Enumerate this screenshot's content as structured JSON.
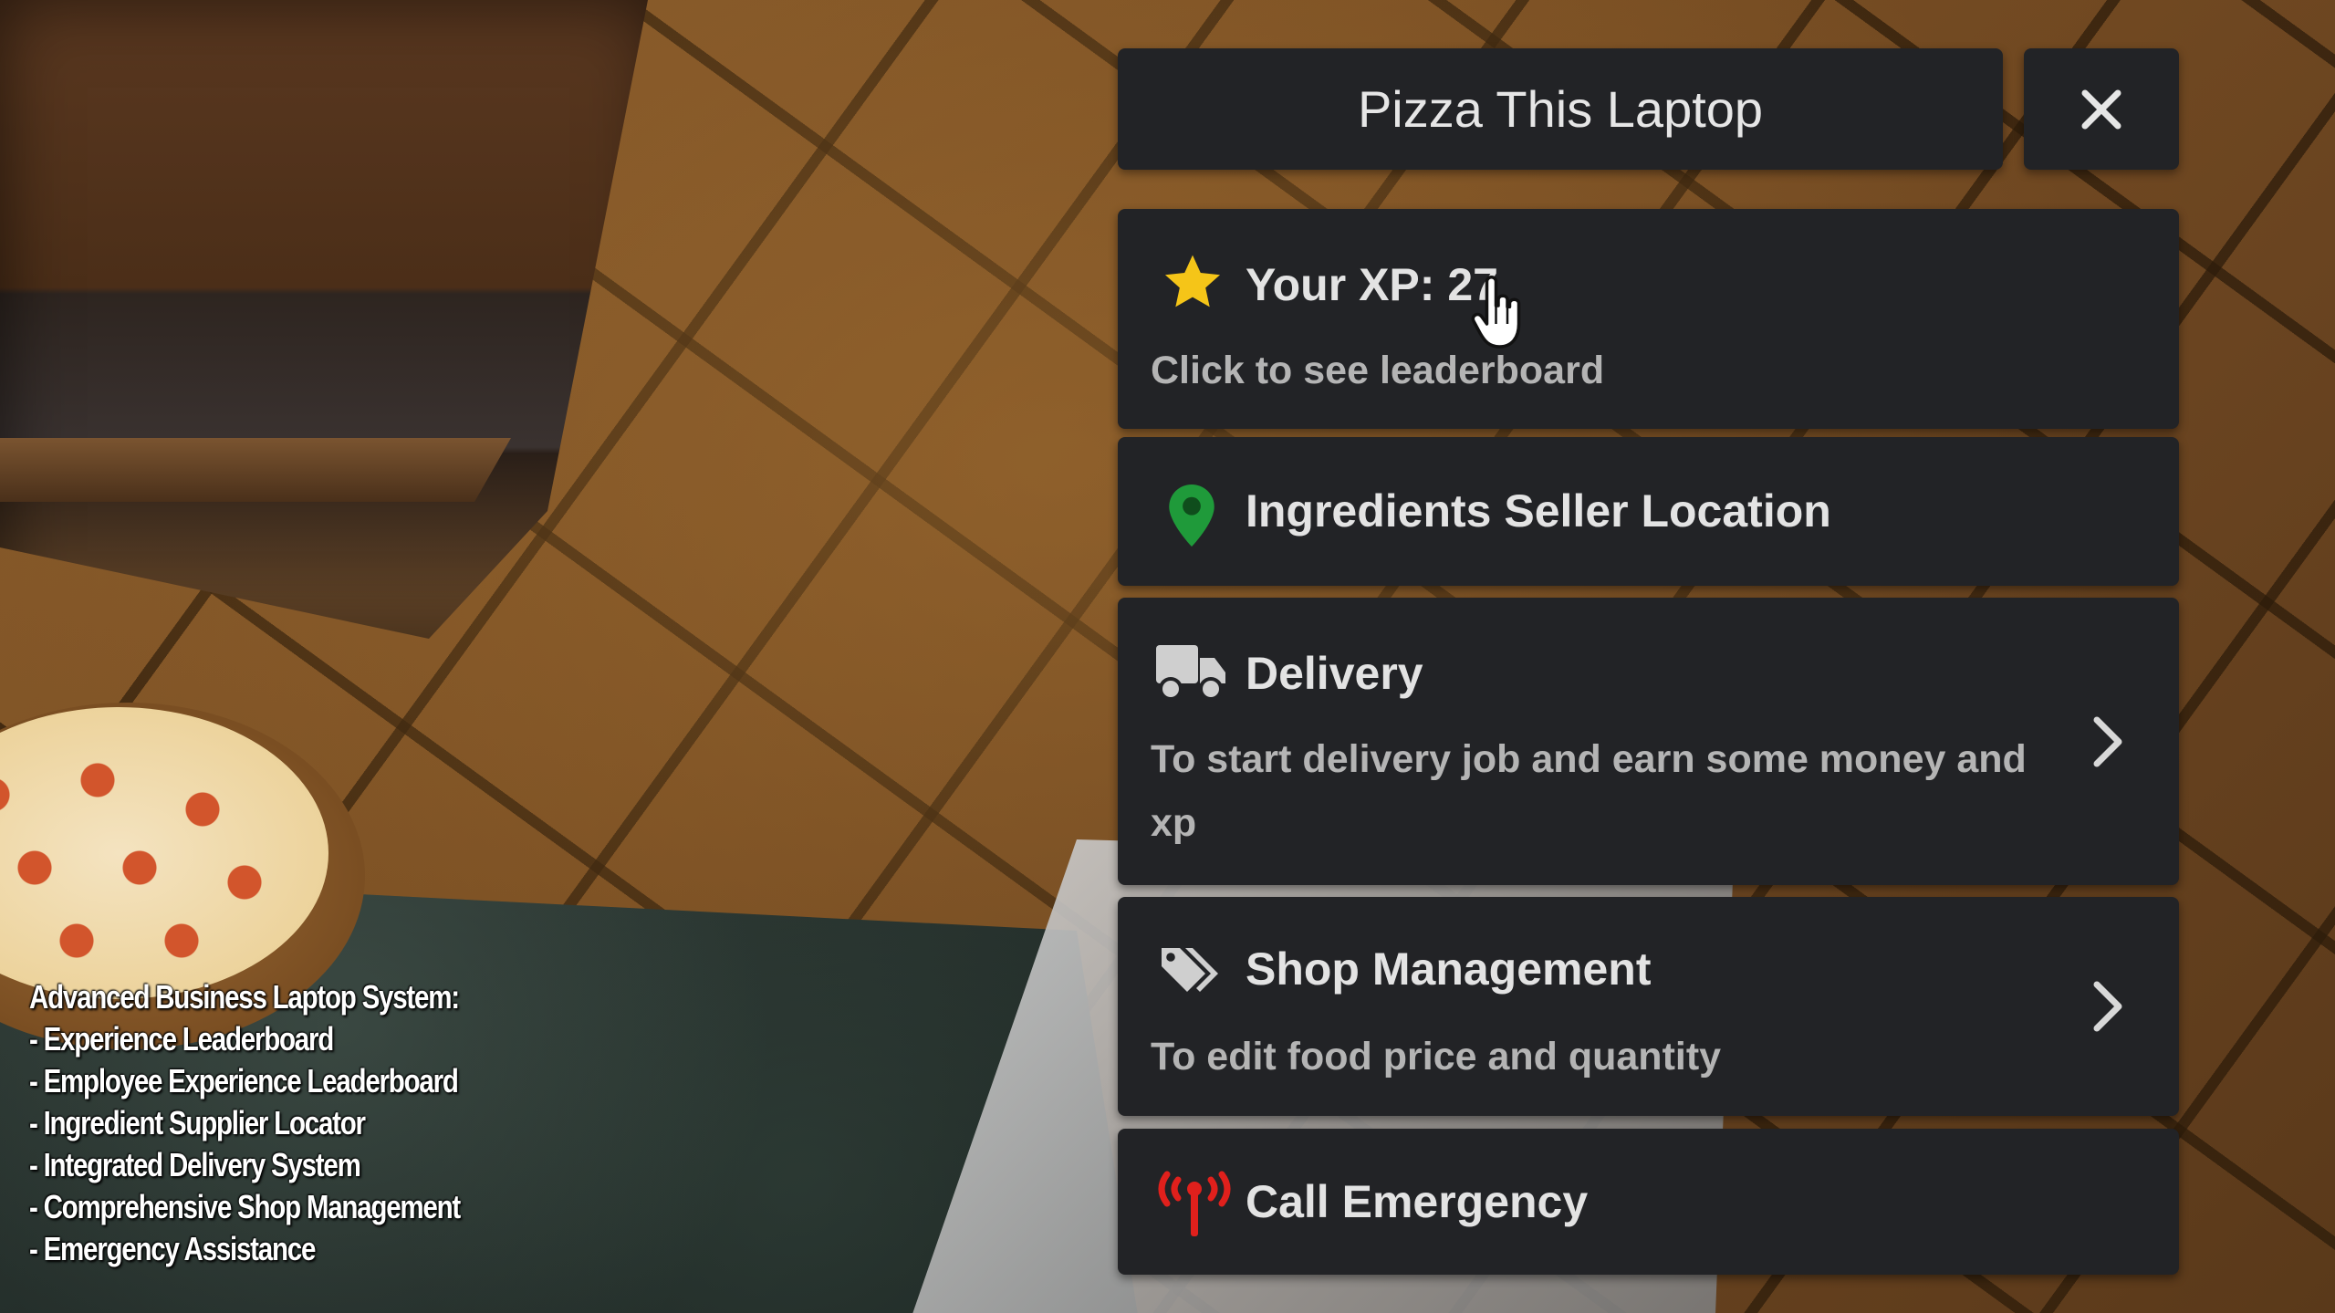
{
  "window": {
    "title": "Pizza This Laptop",
    "close_icon": "close-icon"
  },
  "menu": {
    "xp": {
      "icon": "star-icon",
      "title": "Your XP: 27",
      "subtitle": "Click to see leaderboard"
    },
    "ingredients": {
      "icon": "map-pin-icon",
      "title": "Ingredients Seller Location"
    },
    "delivery": {
      "icon": "truck-icon",
      "title": "Delivery",
      "description": "To start delivery job and earn some money and xp"
    },
    "shop": {
      "icon": "tags-icon",
      "title": "Shop Management",
      "description": "To edit food price and quantity"
    },
    "emergency": {
      "icon": "tower-broadcast-icon",
      "title": "Call Emergency"
    }
  },
  "caption": {
    "lines": [
      "Advanced Business Laptop System:",
      "- Experience Leaderboard",
      "- Employee Experience Leaderboard",
      "- Ingredient Supplier Locator",
      "- Integrated Delivery System",
      "- Comprehensive Shop Management",
      "- Emergency Assistance"
    ]
  },
  "colors": {
    "panel_bg": "#222326",
    "title_text": "#e6e6e6",
    "subtext": "#b4b4b4",
    "star": "#f5c518",
    "pin": "#1f9a3a",
    "emergency": "#e0201c",
    "icon_gray": "#cfcfcf"
  }
}
